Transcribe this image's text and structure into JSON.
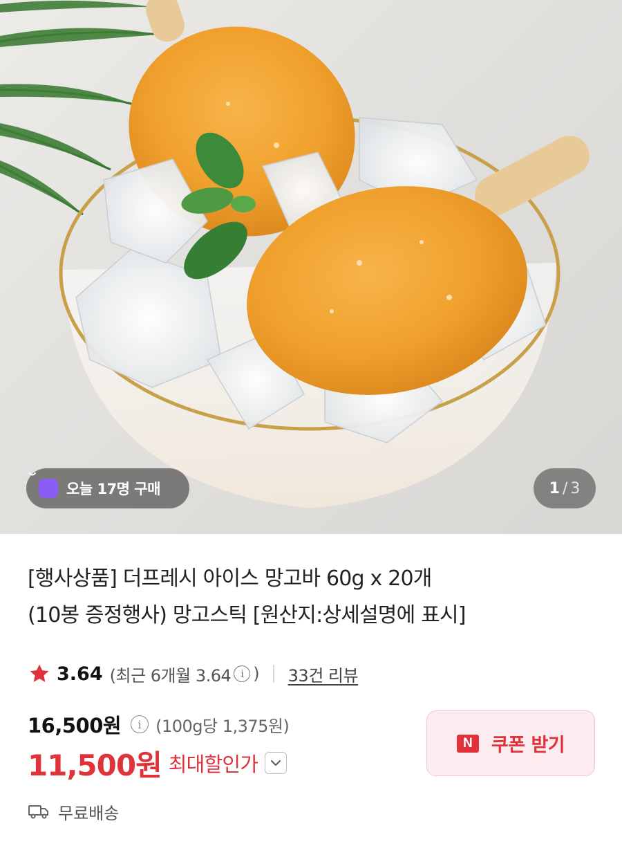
{
  "hero": {
    "badge_today": "오늘 17명 구매",
    "page_current": "1",
    "page_separator": "/",
    "page_total": "3"
  },
  "product": {
    "title_line1": "[행사상품] 더프레시 아이스 망고바 60g x 20개",
    "title_line2": "(10봉 증정행사) 망고스틱 [원산지:상세설명에 표시]"
  },
  "rating": {
    "score": "3.64",
    "recent_prefix": "(최근 6개월 3.64",
    "recent_suffix": ")",
    "review_link": "33건 리뷰"
  },
  "price": {
    "original": "16,500원",
    "per_unit": "(100g당 1,375원)",
    "sale": "11,500원",
    "sale_label": "최대할인가"
  },
  "coupon": {
    "label": "쿠폰 받기",
    "icon_letter": "N"
  },
  "shipping": {
    "label": "무료배송"
  },
  "colors": {
    "accent_red": "#e0323a",
    "coupon_bg": "#fdecef",
    "bag_purple": "#8b5cf6"
  },
  "icons": [
    "shopping-bag-icon",
    "star-icon",
    "info-icon",
    "chevron-down-icon",
    "n-pay-icon",
    "truck-icon"
  ]
}
